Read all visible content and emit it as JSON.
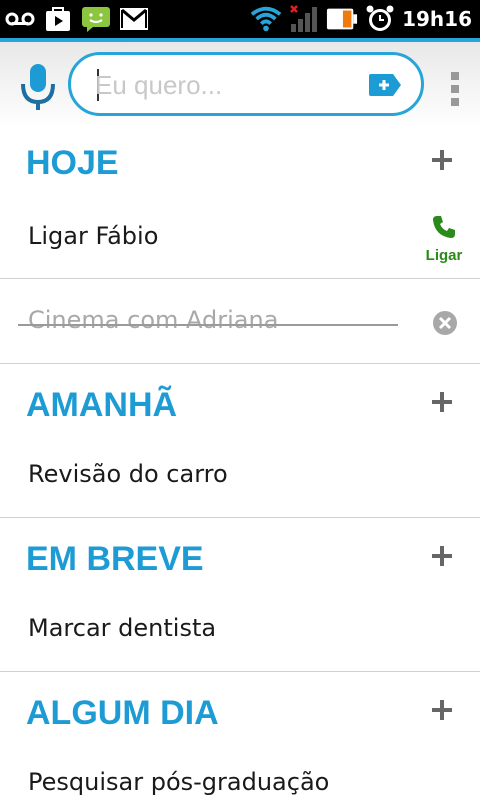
{
  "status_bar": {
    "clock": "19h16",
    "left_icons": [
      "voicemail-icon",
      "play-store-icon",
      "sms-icon",
      "gmail-icon"
    ],
    "right_icons": [
      "wifi-icon",
      "signal-icon",
      "battery-icon",
      "alarm-icon"
    ]
  },
  "header": {
    "search_placeholder": "Eu quero...",
    "search_value": "",
    "icons": [
      "mic-icon",
      "add-tag-icon",
      "overflow-menu-icon"
    ]
  },
  "colors": {
    "accent": "#1d9bd4",
    "call_green": "#2a8a1a",
    "text": "#1a1a1a",
    "done_text": "#a8a8a8"
  },
  "sections": [
    {
      "title": "HOJE",
      "items": [
        {
          "text": "Ligar Fábio",
          "done": false,
          "action": "Ligar"
        },
        {
          "text": "Cinema com Adriana",
          "done": true
        }
      ]
    },
    {
      "title": "AMANHÃ",
      "items": [
        {
          "text": "Revisão do carro",
          "done": false
        }
      ]
    },
    {
      "title": "EM BREVE",
      "items": [
        {
          "text": "Marcar dentista",
          "done": false
        }
      ]
    },
    {
      "title": "ALGUM DIA",
      "items": [
        {
          "text": "Pesquisar pós-graduação",
          "done": false
        }
      ]
    }
  ]
}
